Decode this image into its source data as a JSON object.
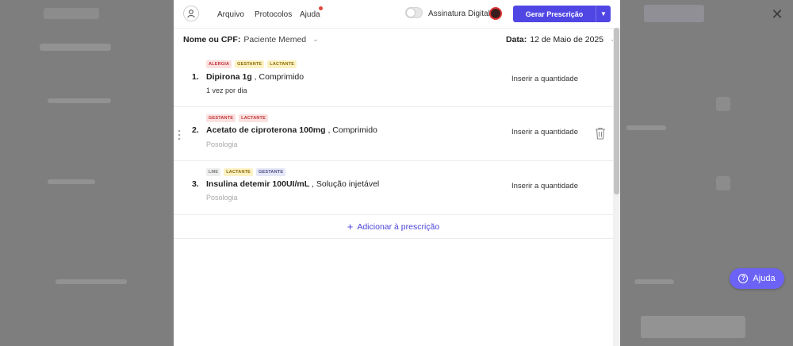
{
  "header": {
    "menu": [
      "Arquivo",
      "Protocolos",
      "Ajuda"
    ],
    "signature_label": "Assinatura Digital",
    "generate_label": "Gerar Prescrição"
  },
  "patient": {
    "label": "Nome ou CPF:",
    "value": "Paciente Memed"
  },
  "date": {
    "label": "Data:",
    "value": "12 de Maio de 2025"
  },
  "items": [
    {
      "number": "1.",
      "tags": [
        {
          "text": "ALERGIA",
          "color": "#c03535"
        },
        {
          "text": "GESTANTE",
          "color": "#8a6a00"
        },
        {
          "text": "LACTANTE",
          "color": "#8a6a00"
        }
      ],
      "drug_name": "Dipirona 1g",
      "drug_form": " , Comprimido",
      "posology": "1 vez por dia",
      "quantity": "Inserir a quantidade"
    },
    {
      "number": "2.",
      "tags": [
        {
          "text": "GESTANTE",
          "color": "#c03535"
        },
        {
          "text": "LACTANTE",
          "color": "#c03535"
        }
      ],
      "drug_name": "Acetato de ciproterona 100mg",
      "drug_form": " , Comprimido",
      "posology": "Posologia",
      "quantity": "Inserir a quantidade"
    },
    {
      "number": "3.",
      "tags": [
        {
          "text": "LME",
          "color": "#777777"
        },
        {
          "text": "LACTANTE",
          "color": "#8a6a00"
        },
        {
          "text": "GESTANTE",
          "color": "#4c4f86"
        }
      ],
      "drug_name": "Insulina detemir 100UI/mL",
      "drug_form": " , Solução injetável",
      "posology": "Posologia",
      "quantity": "Inserir a quantidade"
    }
  ],
  "add_label": "Adicionar à prescrição",
  "help_label": "Ajuda",
  "colors": {
    "accent": "#5046e4",
    "help": "#6c63f6"
  },
  "icons": [
    "user-icon",
    "chevron-down-icon",
    "drag-handle-icon",
    "trash-icon",
    "plus-icon",
    "close-icon",
    "help-icon"
  ]
}
